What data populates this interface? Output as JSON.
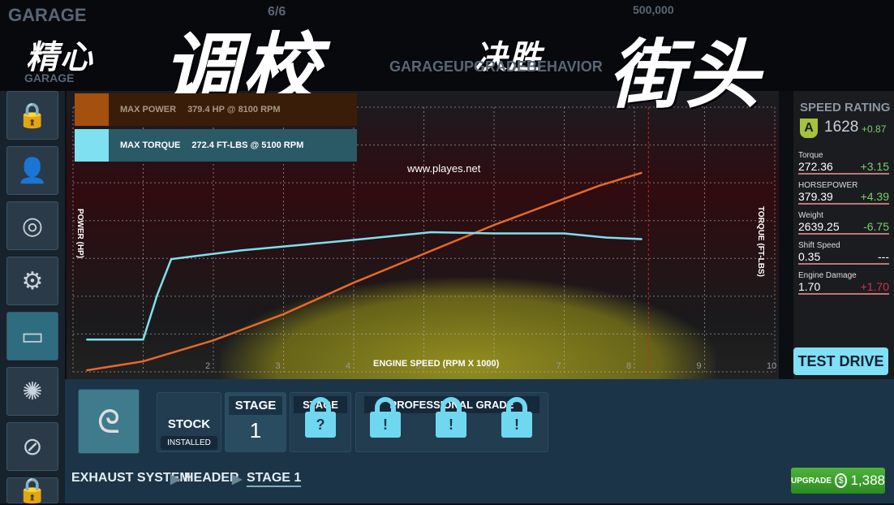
{
  "topbar": {
    "garage_label": "GARAGE",
    "count": "6/6",
    "money": "500,000",
    "back_label": "GARAGE",
    "screen_title": "GARAGEUPGRADEBEHAVIOR"
  },
  "banner": {
    "text1": "精心",
    "text2": "调校",
    "text3": "决胜",
    "text4": "街头"
  },
  "watermark": "www.playes.net",
  "sidebar": {
    "items": [
      {
        "icon": "lock-icon"
      },
      {
        "icon": "driver-avatar"
      },
      {
        "icon": "tire-icon"
      },
      {
        "icon": "piston-icon"
      },
      {
        "icon": "exhaust-icon",
        "selected": true
      },
      {
        "icon": "brake-disc-icon"
      },
      {
        "icon": "air-filter-icon"
      },
      {
        "icon": "lock-icon"
      }
    ]
  },
  "legend": {
    "power_label": "MAX POWER",
    "power_value": "379.4 HP @ 8100 RPM",
    "torque_label": "MAX TORQUE",
    "torque_value": "272.4 FT-LBS @ 5100 RPM"
  },
  "chart_data": {
    "type": "line",
    "xlabel": "ENGINE SPEED (RPM X 1000)",
    "ylabel_left": "POWER (HP)",
    "ylabel_right": "TORQUE (FT-LBS)",
    "x_ticks": [
      "2",
      "3",
      "4",
      "5",
      "6",
      "7",
      "8",
      "9",
      "10"
    ],
    "xlim": [
      0,
      10
    ],
    "grid": true,
    "series": [
      {
        "key": "power",
        "color": "#e8692a",
        "x": [
          0.2,
          1.0,
          2.0,
          3.0,
          4.0,
          5.0,
          6.0,
          7.0,
          7.5,
          8.1
        ],
        "y": [
          3,
          20,
          60,
          110,
          170,
          225,
          280,
          330,
          355,
          379.4
        ]
      },
      {
        "key": "torque",
        "color": "#7fe0f0",
        "x": [
          0.2,
          1.0,
          1.2,
          1.4,
          2.4,
          3.9,
          5.1,
          6.0,
          7.0,
          7.6,
          8.1
        ],
        "y": [
          63,
          63,
          150,
          220,
          237,
          256,
          272.4,
          270,
          270,
          262,
          259
        ]
      }
    ]
  },
  "rating": {
    "title": "SPEED RATING",
    "class": "A",
    "value": "1628",
    "delta": "+0.87"
  },
  "stats": [
    {
      "label": "Torque",
      "value": "272.36",
      "delta": "+3.15",
      "color": "#7ccf6a"
    },
    {
      "label": "HORSEPOWER",
      "value": "379.39",
      "delta": "+4.39",
      "color": "#7ccf6a"
    },
    {
      "label": "Weight",
      "value": "2639.25",
      "delta": "-6.75",
      "color": "#7ccf6a"
    },
    {
      "label": "Shift Speed",
      "value": "0.35",
      "delta": "---",
      "color": "#ffffff"
    },
    {
      "label": "Engine Damage",
      "value": "1.70",
      "delta": "+1.70",
      "color": "#d0304a"
    }
  ],
  "test_drive": "TEST DRIVE",
  "stages": {
    "stock": "STOCK",
    "installed": "INSTALLED",
    "stage_label": "STAGE",
    "stage_num": "1",
    "stage2_label": "STAGE",
    "pro_label": "PROFESSIONAL GRADE",
    "lock_glyph": "?"
  },
  "breadcrumb": [
    "EXHAUST SYSTEM",
    "HEADER",
    "STAGE 1"
  ],
  "upgrade": {
    "label": "UPGRADE",
    "price": "1,388",
    "currency_icon": "coin-icon"
  }
}
